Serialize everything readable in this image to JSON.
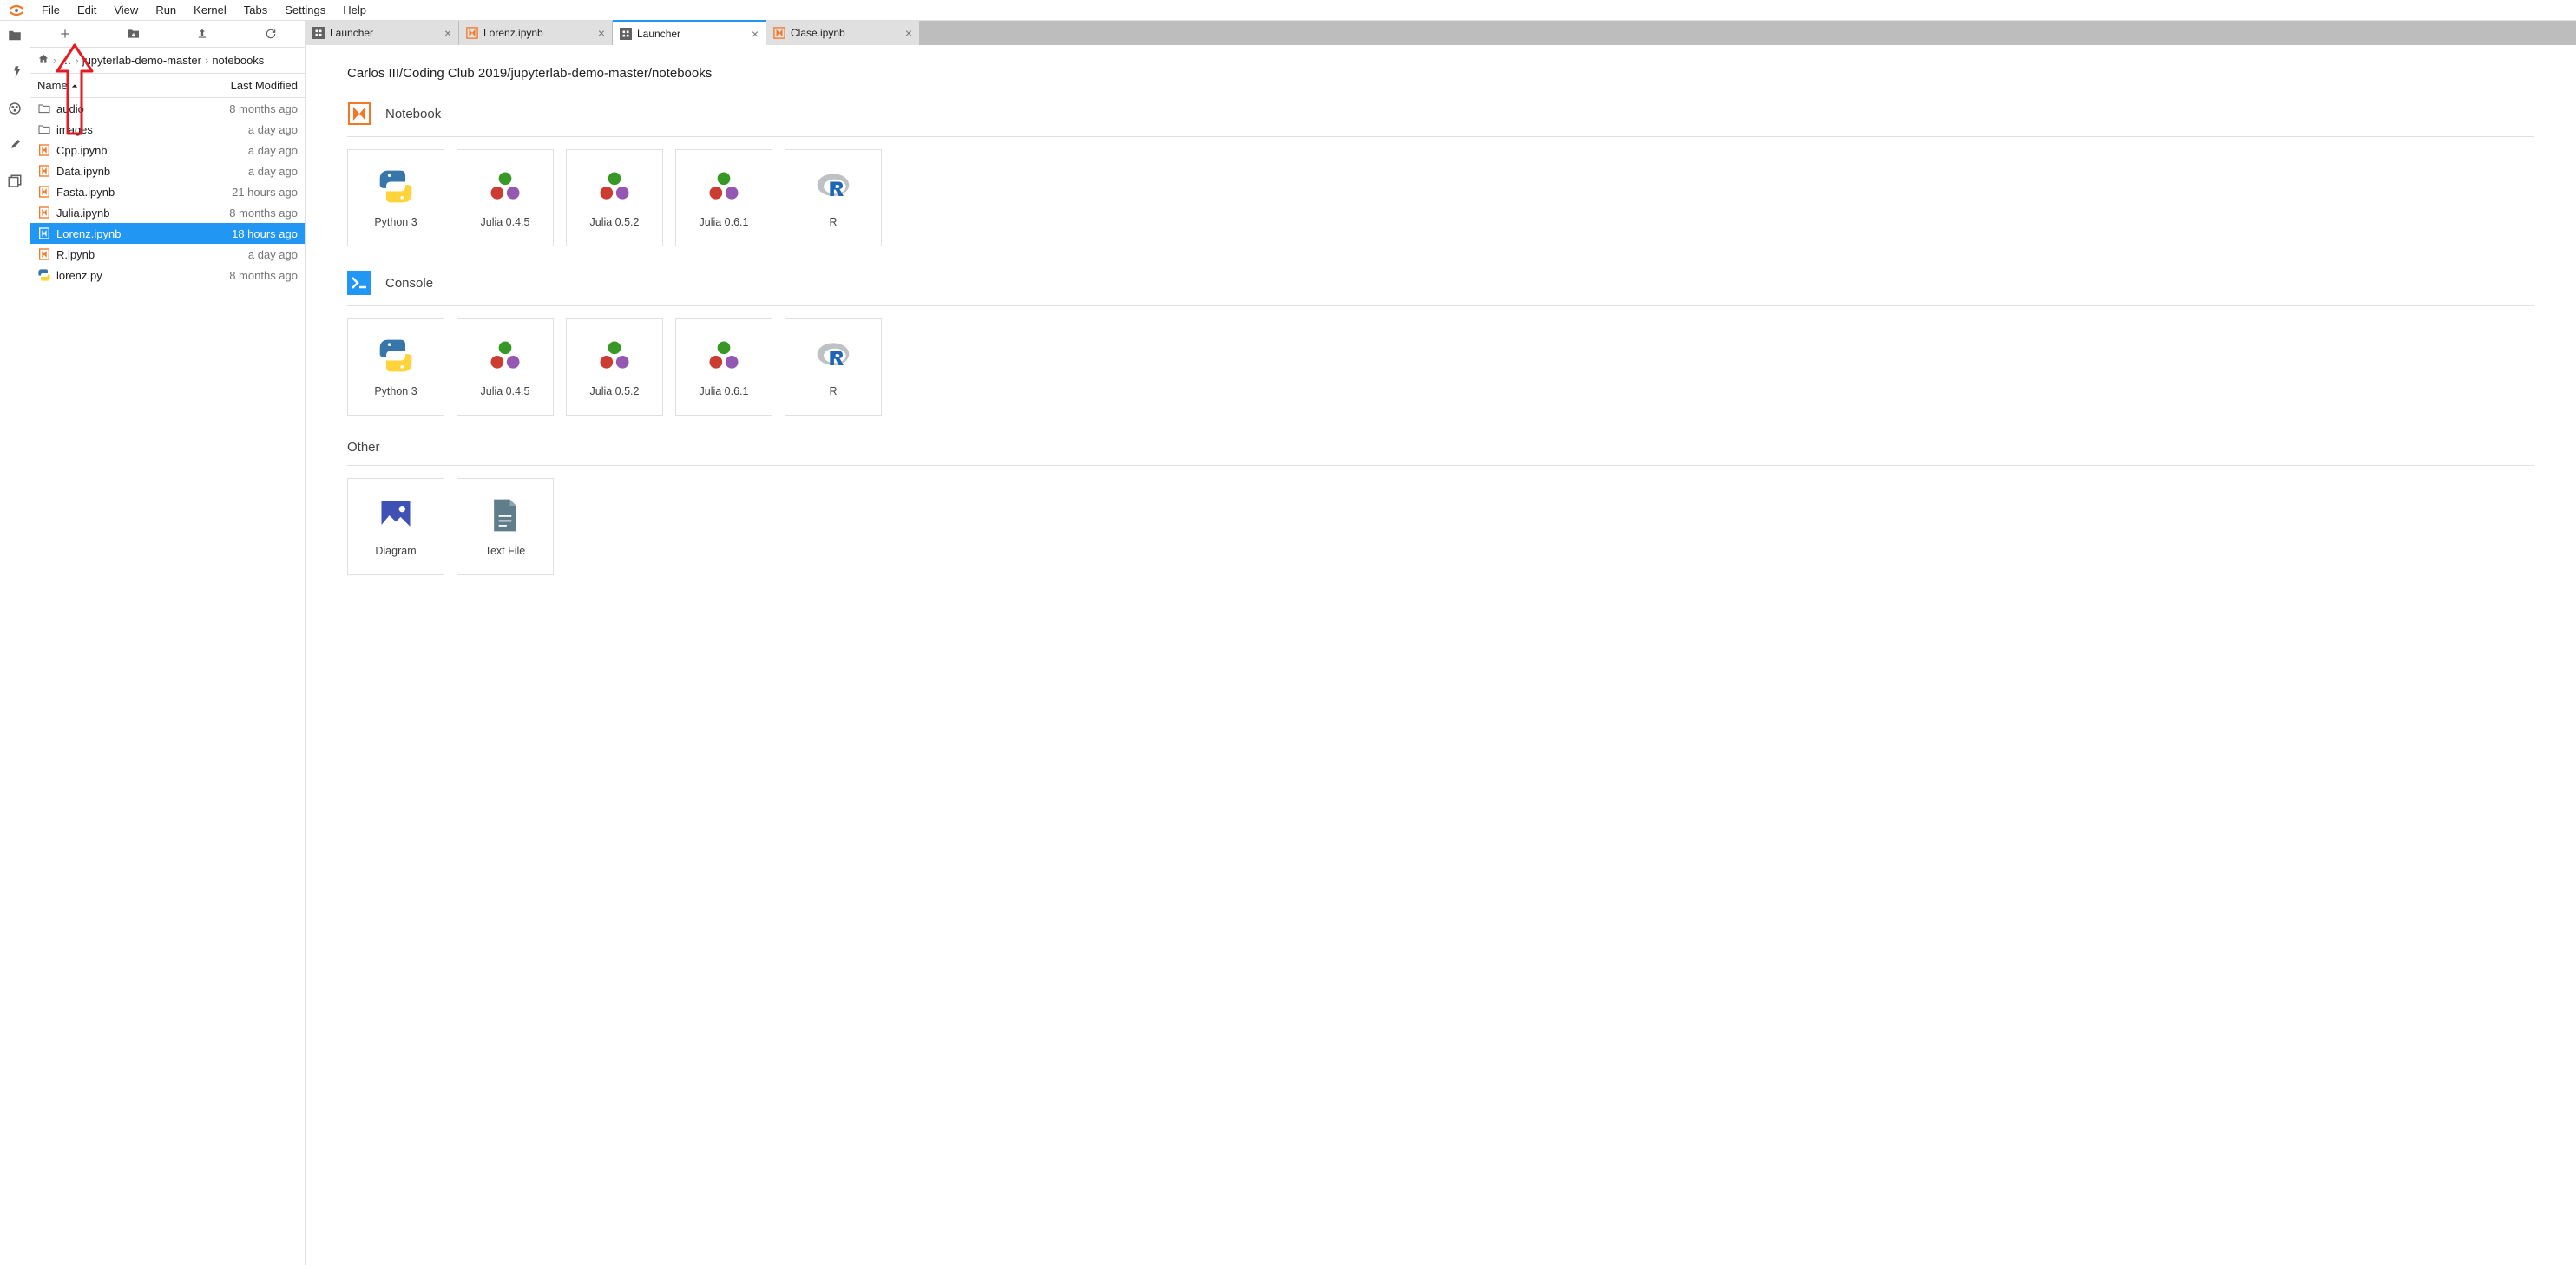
{
  "menu": [
    "File",
    "Edit",
    "View",
    "Run",
    "Kernel",
    "Tabs",
    "Settings",
    "Help"
  ],
  "breadcrumb": {
    "root": "",
    "dots": "…",
    "parts": [
      "jupyterlab-demo-master",
      "notebooks"
    ]
  },
  "fileHeader": {
    "name": "Name",
    "mod": "Last Modified"
  },
  "files": [
    {
      "type": "folder",
      "name": "audio",
      "mod": "8 months ago"
    },
    {
      "type": "folder",
      "name": "images",
      "mod": "a day ago"
    },
    {
      "type": "notebook",
      "name": "Cpp.ipynb",
      "mod": "a day ago"
    },
    {
      "type": "notebook",
      "name": "Data.ipynb",
      "mod": "a day ago"
    },
    {
      "type": "notebook",
      "name": "Fasta.ipynb",
      "mod": "21 hours ago"
    },
    {
      "type": "notebook",
      "name": "Julia.ipynb",
      "mod": "8 months ago"
    },
    {
      "type": "notebook",
      "name": "Lorenz.ipynb",
      "mod": "18 hours ago",
      "selected": true
    },
    {
      "type": "notebook",
      "name": "R.ipynb",
      "mod": "a day ago"
    },
    {
      "type": "python",
      "name": "lorenz.py",
      "mod": "8 months ago"
    }
  ],
  "tabs": [
    {
      "icon": "launcher",
      "label": "Launcher"
    },
    {
      "icon": "notebook",
      "label": "Lorenz.ipynb"
    },
    {
      "icon": "launcher",
      "label": "Launcher",
      "active": true
    },
    {
      "icon": "notebook",
      "label": "Clase.ipynb"
    }
  ],
  "launcher": {
    "path": "Carlos III/Coding Club 2019/jupyterlab-demo-master/notebooks",
    "sections": [
      {
        "title": "Notebook",
        "icon": "notebook",
        "cards": [
          {
            "icon": "python",
            "label": "Python 3"
          },
          {
            "icon": "julia",
            "label": "Julia 0.4.5"
          },
          {
            "icon": "julia",
            "label": "Julia 0.5.2"
          },
          {
            "icon": "julia",
            "label": "Julia 0.6.1"
          },
          {
            "icon": "r",
            "label": "R"
          }
        ]
      },
      {
        "title": "Console",
        "icon": "console",
        "cards": [
          {
            "icon": "python",
            "label": "Python 3"
          },
          {
            "icon": "julia",
            "label": "Julia 0.4.5"
          },
          {
            "icon": "julia",
            "label": "Julia 0.5.2"
          },
          {
            "icon": "julia",
            "label": "Julia 0.6.1"
          },
          {
            "icon": "r",
            "label": "R"
          }
        ]
      },
      {
        "title": "Other",
        "icon": "",
        "cards": [
          {
            "icon": "diagram",
            "label": "Diagram"
          },
          {
            "icon": "text",
            "label": "Text File"
          }
        ]
      }
    ]
  }
}
